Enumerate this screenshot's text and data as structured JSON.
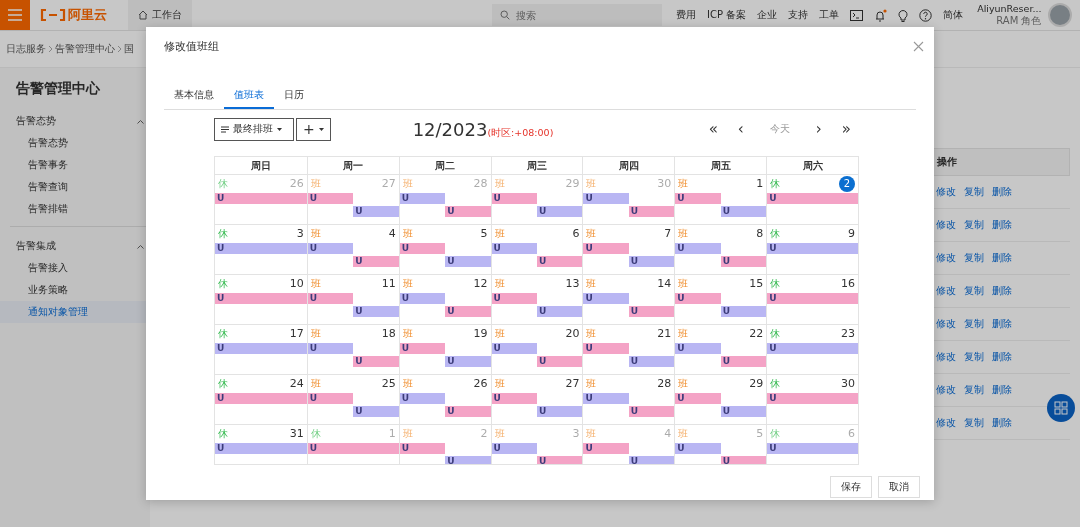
{
  "topbar": {
    "brand": "阿里云",
    "workbench": "工作台",
    "search": {
      "placeholder": "搜索"
    },
    "links": [
      "费用",
      "ICP 备案",
      "企业",
      "支持",
      "工单"
    ],
    "notification_dot": true,
    "language": "简体",
    "user": {
      "name": "AliyunReser...",
      "role": "RAM 角色"
    }
  },
  "breadcrumb": [
    "日志服务",
    "告警管理中心",
    "国"
  ],
  "sidebar": {
    "title": "告警管理中心",
    "groups": [
      {
        "label": "告警态势",
        "expanded": true,
        "children": [
          {
            "label": "告警态势",
            "selected": false
          },
          {
            "label": "告警事务",
            "selected": false
          },
          {
            "label": "告警查询",
            "selected": false
          },
          {
            "label": "告警排错",
            "selected": false
          }
        ]
      },
      {
        "label": "告警集成",
        "expanded": true,
        "children": [
          {
            "label": "告警接入",
            "selected": false
          },
          {
            "label": "业务策略",
            "selected": false
          },
          {
            "label": "通知对象管理",
            "selected": true
          }
        ]
      }
    ]
  },
  "table": {
    "header": "操作",
    "rows": [
      {
        "actions": [
          "修改",
          "复制",
          "删除"
        ]
      },
      {
        "actions": [
          "修改",
          "复制",
          "删除"
        ]
      },
      {
        "actions": [
          "修改",
          "复制",
          "删除"
        ]
      },
      {
        "actions": [
          "修改",
          "复制",
          "删除"
        ]
      },
      {
        "actions": [
          "修改",
          "复制",
          "删除"
        ]
      },
      {
        "actions": [
          "修改",
          "复制",
          "删除"
        ]
      },
      {
        "actions": [
          "修改",
          "复制",
          "删除"
        ]
      },
      {
        "actions": [
          "修改",
          "复制",
          "删除"
        ]
      }
    ]
  },
  "dialog": {
    "title": "修改值班组",
    "tabs": [
      {
        "label": "基本信息",
        "selected": false
      },
      {
        "label": "值班表",
        "selected": true
      },
      {
        "label": "日历",
        "selected": false
      }
    ],
    "toolbar": {
      "view_button": "最终排班",
      "add_button": "+"
    },
    "month": "12/2023",
    "timezone": "(时区:+08:00)",
    "nav": [
      {
        "label": "«",
        "disabled": false
      },
      {
        "label": "‹",
        "disabled": false
      },
      {
        "label": "今天",
        "disabled": true
      },
      {
        "label": "›",
        "disabled": false
      },
      {
        "label": "»",
        "disabled": false
      }
    ],
    "calendar": {
      "weekdays": [
        "周日",
        "周一",
        "周二",
        "周三",
        "周四",
        "周五",
        "周六"
      ],
      "weeks": [
        [
          {
            "day": "26",
            "tag": {
              "kind": "rest",
              "text": "休"
            },
            "muted": true,
            "today": false,
            "events": [
              {
                "kind": "full",
                "color": "#f4a3c6",
                "label": "U"
              }
            ]
          },
          {
            "day": "27",
            "tag": {
              "kind": "work",
              "text": "班"
            },
            "muted": true,
            "today": false,
            "events": [
              {
                "kind": "am",
                "color": "#f4a3c6",
                "label": "U"
              },
              {
                "kind": "pm",
                "color": "#b9b6f3",
                "label": "U"
              }
            ]
          },
          {
            "day": "28",
            "tag": {
              "kind": "work",
              "text": "班"
            },
            "muted": true,
            "today": false,
            "events": [
              {
                "kind": "am",
                "color": "#b9b6f3",
                "label": "U"
              },
              {
                "kind": "pm",
                "color": "#f4a3c6",
                "label": "U"
              }
            ]
          },
          {
            "day": "29",
            "tag": {
              "kind": "work",
              "text": "班"
            },
            "muted": true,
            "today": false,
            "events": [
              {
                "kind": "am",
                "color": "#f4a3c6",
                "label": "U"
              },
              {
                "kind": "pm",
                "color": "#b9b6f3",
                "label": "U"
              }
            ]
          },
          {
            "day": "30",
            "tag": {
              "kind": "work",
              "text": "班"
            },
            "muted": true,
            "today": false,
            "events": [
              {
                "kind": "am",
                "color": "#b9b6f3",
                "label": "U"
              },
              {
                "kind": "pm",
                "color": "#f4a3c6",
                "label": "U"
              }
            ]
          },
          {
            "day": "1",
            "tag": {
              "kind": "work",
              "text": "班"
            },
            "muted": false,
            "today": false,
            "events": [
              {
                "kind": "am",
                "color": "#f4a3c6",
                "label": "U"
              },
              {
                "kind": "pm",
                "color": "#b9b6f3",
                "label": "U"
              }
            ]
          },
          {
            "day": "2",
            "tag": {
              "kind": "rest",
              "text": "休"
            },
            "muted": false,
            "today": true,
            "events": [
              {
                "kind": "full",
                "color": "#f4a3c6",
                "label": "U"
              }
            ]
          }
        ],
        [
          {
            "day": "3",
            "tag": {
              "kind": "rest",
              "text": "休"
            },
            "muted": false,
            "today": false,
            "events": [
              {
                "kind": "full",
                "color": "#b9b6f3",
                "label": "U"
              }
            ]
          },
          {
            "day": "4",
            "tag": {
              "kind": "work",
              "text": "班"
            },
            "muted": false,
            "today": false,
            "events": [
              {
                "kind": "am",
                "color": "#b9b6f3",
                "label": "U"
              },
              {
                "kind": "pm",
                "color": "#f4a3c6",
                "label": "U"
              }
            ]
          },
          {
            "day": "5",
            "tag": {
              "kind": "work",
              "text": "班"
            },
            "muted": false,
            "today": false,
            "events": [
              {
                "kind": "am",
                "color": "#f4a3c6",
                "label": "U"
              },
              {
                "kind": "pm",
                "color": "#b9b6f3",
                "label": "U"
              }
            ]
          },
          {
            "day": "6",
            "tag": {
              "kind": "work",
              "text": "班"
            },
            "muted": false,
            "today": false,
            "events": [
              {
                "kind": "am",
                "color": "#b9b6f3",
                "label": "U"
              },
              {
                "kind": "pm",
                "color": "#f4a3c6",
                "label": "U"
              }
            ]
          },
          {
            "day": "7",
            "tag": {
              "kind": "work",
              "text": "班"
            },
            "muted": false,
            "today": false,
            "events": [
              {
                "kind": "am",
                "color": "#f4a3c6",
                "label": "U"
              },
              {
                "kind": "pm",
                "color": "#b9b6f3",
                "label": "U"
              }
            ]
          },
          {
            "day": "8",
            "tag": {
              "kind": "work",
              "text": "班"
            },
            "muted": false,
            "today": false,
            "events": [
              {
                "kind": "am",
                "color": "#b9b6f3",
                "label": "U"
              },
              {
                "kind": "pm",
                "color": "#f4a3c6",
                "label": "U"
              }
            ]
          },
          {
            "day": "9",
            "tag": {
              "kind": "rest",
              "text": "休"
            },
            "muted": false,
            "today": false,
            "events": [
              {
                "kind": "full",
                "color": "#b9b6f3",
                "label": "U"
              }
            ]
          }
        ],
        [
          {
            "day": "10",
            "tag": {
              "kind": "rest",
              "text": "休"
            },
            "muted": false,
            "today": false,
            "events": [
              {
                "kind": "full",
                "color": "#f4a3c6",
                "label": "U"
              }
            ]
          },
          {
            "day": "11",
            "tag": {
              "kind": "work",
              "text": "班"
            },
            "muted": false,
            "today": false,
            "events": [
              {
                "kind": "am",
                "color": "#f4a3c6",
                "label": "U"
              },
              {
                "kind": "pm",
                "color": "#b9b6f3",
                "label": "U"
              }
            ]
          },
          {
            "day": "12",
            "tag": {
              "kind": "work",
              "text": "班"
            },
            "muted": false,
            "today": false,
            "events": [
              {
                "kind": "am",
                "color": "#b9b6f3",
                "label": "U"
              },
              {
                "kind": "pm",
                "color": "#f4a3c6",
                "label": "U"
              }
            ]
          },
          {
            "day": "13",
            "tag": {
              "kind": "work",
              "text": "班"
            },
            "muted": false,
            "today": false,
            "events": [
              {
                "kind": "am",
                "color": "#f4a3c6",
                "label": "U"
              },
              {
                "kind": "pm",
                "color": "#b9b6f3",
                "label": "U"
              }
            ]
          },
          {
            "day": "14",
            "tag": {
              "kind": "work",
              "text": "班"
            },
            "muted": false,
            "today": false,
            "events": [
              {
                "kind": "am",
                "color": "#b9b6f3",
                "label": "U"
              },
              {
                "kind": "pm",
                "color": "#f4a3c6",
                "label": "U"
              }
            ]
          },
          {
            "day": "15",
            "tag": {
              "kind": "work",
              "text": "班"
            },
            "muted": false,
            "today": false,
            "events": [
              {
                "kind": "am",
                "color": "#f4a3c6",
                "label": "U"
              },
              {
                "kind": "pm",
                "color": "#b9b6f3",
                "label": "U"
              }
            ]
          },
          {
            "day": "16",
            "tag": {
              "kind": "rest",
              "text": "休"
            },
            "muted": false,
            "today": false,
            "events": [
              {
                "kind": "full",
                "color": "#f4a3c6",
                "label": "U"
              }
            ]
          }
        ],
        [
          {
            "day": "17",
            "tag": {
              "kind": "rest",
              "text": "休"
            },
            "muted": false,
            "today": false,
            "events": [
              {
                "kind": "full",
                "color": "#b9b6f3",
                "label": "U"
              }
            ]
          },
          {
            "day": "18",
            "tag": {
              "kind": "work",
              "text": "班"
            },
            "muted": false,
            "today": false,
            "events": [
              {
                "kind": "am",
                "color": "#b9b6f3",
                "label": "U"
              },
              {
                "kind": "pm",
                "color": "#f4a3c6",
                "label": "U"
              }
            ]
          },
          {
            "day": "19",
            "tag": {
              "kind": "work",
              "text": "班"
            },
            "muted": false,
            "today": false,
            "events": [
              {
                "kind": "am",
                "color": "#f4a3c6",
                "label": "U"
              },
              {
                "kind": "pm",
                "color": "#b9b6f3",
                "label": "U"
              }
            ]
          },
          {
            "day": "20",
            "tag": {
              "kind": "work",
              "text": "班"
            },
            "muted": false,
            "today": false,
            "events": [
              {
                "kind": "am",
                "color": "#b9b6f3",
                "label": "U"
              },
              {
                "kind": "pm",
                "color": "#f4a3c6",
                "label": "U"
              }
            ]
          },
          {
            "day": "21",
            "tag": {
              "kind": "work",
              "text": "班"
            },
            "muted": false,
            "today": false,
            "events": [
              {
                "kind": "am",
                "color": "#f4a3c6",
                "label": "U"
              },
              {
                "kind": "pm",
                "color": "#b9b6f3",
                "label": "U"
              }
            ]
          },
          {
            "day": "22",
            "tag": {
              "kind": "work",
              "text": "班"
            },
            "muted": false,
            "today": false,
            "events": [
              {
                "kind": "am",
                "color": "#b9b6f3",
                "label": "U"
              },
              {
                "kind": "pm",
                "color": "#f4a3c6",
                "label": "U"
              }
            ]
          },
          {
            "day": "23",
            "tag": {
              "kind": "rest",
              "text": "休"
            },
            "muted": false,
            "today": false,
            "events": [
              {
                "kind": "full",
                "color": "#b9b6f3",
                "label": "U"
              }
            ]
          }
        ],
        [
          {
            "day": "24",
            "tag": {
              "kind": "rest",
              "text": "休"
            },
            "muted": false,
            "today": false,
            "events": [
              {
                "kind": "full",
                "color": "#f4a3c6",
                "label": "U"
              }
            ]
          },
          {
            "day": "25",
            "tag": {
              "kind": "work",
              "text": "班"
            },
            "muted": false,
            "today": false,
            "events": [
              {
                "kind": "am",
                "color": "#f4a3c6",
                "label": "U"
              },
              {
                "kind": "pm",
                "color": "#b9b6f3",
                "label": "U"
              }
            ]
          },
          {
            "day": "26",
            "tag": {
              "kind": "work",
              "text": "班"
            },
            "muted": false,
            "today": false,
            "events": [
              {
                "kind": "am",
                "color": "#b9b6f3",
                "label": "U"
              },
              {
                "kind": "pm",
                "color": "#f4a3c6",
                "label": "U"
              }
            ]
          },
          {
            "day": "27",
            "tag": {
              "kind": "work",
              "text": "班"
            },
            "muted": false,
            "today": false,
            "events": [
              {
                "kind": "am",
                "color": "#f4a3c6",
                "label": "U"
              },
              {
                "kind": "pm",
                "color": "#b9b6f3",
                "label": "U"
              }
            ]
          },
          {
            "day": "28",
            "tag": {
              "kind": "work",
              "text": "班"
            },
            "muted": false,
            "today": false,
            "events": [
              {
                "kind": "am",
                "color": "#b9b6f3",
                "label": "U"
              },
              {
                "kind": "pm",
                "color": "#f4a3c6",
                "label": "U"
              }
            ]
          },
          {
            "day": "29",
            "tag": {
              "kind": "work",
              "text": "班"
            },
            "muted": false,
            "today": false,
            "events": [
              {
                "kind": "am",
                "color": "#f4a3c6",
                "label": "U"
              },
              {
                "kind": "pm",
                "color": "#b9b6f3",
                "label": "U"
              }
            ]
          },
          {
            "day": "30",
            "tag": {
              "kind": "rest",
              "text": "休"
            },
            "muted": false,
            "today": false,
            "events": [
              {
                "kind": "full",
                "color": "#f4a3c6",
                "label": "U"
              }
            ]
          }
        ],
        [
          {
            "day": "31",
            "tag": {
              "kind": "rest",
              "text": "休"
            },
            "muted": false,
            "today": false,
            "events": [
              {
                "kind": "full",
                "color": "#b9b6f3",
                "label": "U"
              }
            ]
          },
          {
            "day": "1",
            "tag": {
              "kind": "rest",
              "text": "休"
            },
            "muted": true,
            "today": false,
            "events": [
              {
                "kind": "full",
                "color": "#f4a3c6",
                "label": "U"
              }
            ]
          },
          {
            "day": "2",
            "tag": {
              "kind": "work",
              "text": "班"
            },
            "muted": true,
            "today": false,
            "events": [
              {
                "kind": "am",
                "color": "#f4a3c6",
                "label": "U"
              },
              {
                "kind": "pm",
                "color": "#b9b6f3",
                "label": "U"
              }
            ]
          },
          {
            "day": "3",
            "tag": {
              "kind": "work",
              "text": "班"
            },
            "muted": true,
            "today": false,
            "events": [
              {
                "kind": "am",
                "color": "#b9b6f3",
                "label": "U"
              },
              {
                "kind": "pm",
                "color": "#f4a3c6",
                "label": "U"
              }
            ]
          },
          {
            "day": "4",
            "tag": {
              "kind": "work",
              "text": "班"
            },
            "muted": true,
            "today": false,
            "events": [
              {
                "kind": "am",
                "color": "#f4a3c6",
                "label": "U"
              },
              {
                "kind": "pm",
                "color": "#b9b6f3",
                "label": "U"
              }
            ]
          },
          {
            "day": "5",
            "tag": {
              "kind": "work",
              "text": "班"
            },
            "muted": true,
            "today": false,
            "events": [
              {
                "kind": "am",
                "color": "#b9b6f3",
                "label": "U"
              },
              {
                "kind": "pm",
                "color": "#f4a3c6",
                "label": "U"
              }
            ]
          },
          {
            "day": "6",
            "tag": {
              "kind": "rest",
              "text": "休"
            },
            "muted": true,
            "today": false,
            "events": [
              {
                "kind": "full",
                "color": "#b9b6f3",
                "label": "U"
              }
            ]
          }
        ]
      ]
    },
    "buttons": [
      "保存",
      "取消"
    ]
  }
}
